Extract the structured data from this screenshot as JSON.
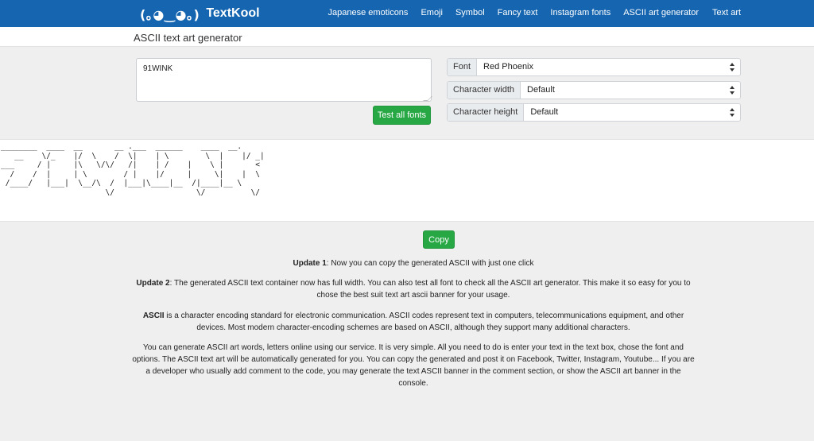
{
  "nav": {
    "logo": "(｡◕‿◕｡)",
    "brand": "TextKool",
    "links": [
      "Japanese emoticons",
      "Emoji",
      "Symbol",
      "Fancy text",
      "Instagram fonts",
      "ASCII art generator"
    ],
    "last_link": "Text art"
  },
  "page": {
    "title": "ASCII text art generator"
  },
  "form": {
    "text_value": "91WINK",
    "test_button": "Test all fonts",
    "font": {
      "label": "Font",
      "value": "Red Phoenix"
    },
    "char_width": {
      "label": "Character width",
      "value": "Default"
    },
    "char_height": {
      "label": "Character height",
      "value": "Default"
    }
  },
  "output": {
    "ascii_art": "________  ____  __       __ .___  ______    ____  __.\n   __    \\/_    |/  \\    /  \\|    | \\        \\  |    |/ _|\n___     / |     |\\   \\/\\/   /|    | /    |    \\ |       <\n  /    /  |     | \\        / |    |/     |     \\|    |  \\\n /____/   |___|  \\__/\\  /  |___|\\____|__  /|____|__ \\\n                       \\/                  \\/          \\/"
  },
  "actions": {
    "copy_button": "Copy"
  },
  "info": {
    "update1_label": "Update 1",
    "update1_text": ": Now you can copy the generated ASCII with just one click",
    "update2_label": "Update 2",
    "update2_text": ": The generated ASCII text container now has full width. You can also test all font to check all the ASCII art generator. This make it so easy for you to chose the best suit text art ascii banner for your usage.",
    "ascii_label": "ASCII",
    "ascii_text": " is a character encoding standard for electronic communication. ASCII codes represent text in computers, telecommunications equipment, and other devices. Most modern character-encoding schemes are based on ASCII, although they support many additional characters.",
    "usage_text": "You can generate ASCII art words, letters online using our service. It is very simple. All you need to do is enter your text in the text box, chose the font and options. The ASCII text art will be automatically generated for you. You can copy the generated and post it on Facebook, Twitter, Instagram, Youtube... If you are a developer who usually add comment to the code, you may generate the text ASCII banner in the comment section, or show the ASCII art banner in the console."
  }
}
